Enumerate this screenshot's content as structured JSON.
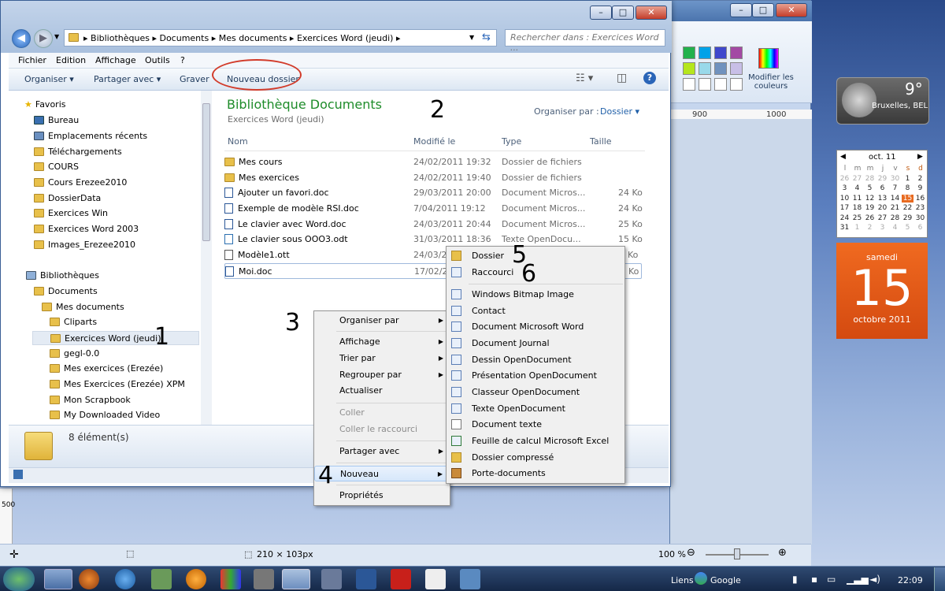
{
  "paint": {
    "modify_colors_label": "Modifier les couleurs",
    "ruler_900": "900",
    "ruler_1000": "1000",
    "left_ruler": "500",
    "selection_size": "210 × 103px",
    "zoom": "100 %"
  },
  "explorer": {
    "address": {
      "crumbs": [
        "Bibliothèques",
        "Documents",
        "Mes documents",
        "Exercices Word (jeudi)"
      ]
    },
    "search_placeholder": "Rechercher dans : Exercices Word ...",
    "menu": [
      "Fichier",
      "Edition",
      "Affichage",
      "Outils",
      "?"
    ],
    "toolbar": {
      "organize": "Organiser ▾",
      "share": "Partager avec ▾",
      "burn": "Graver",
      "new_folder": "Nouveau dossier"
    },
    "nav": {
      "favorites_header": "Favoris",
      "favorites": [
        "Bureau",
        "Emplacements récents",
        "Téléchargements",
        "COURS",
        "Cours Erezee2010",
        "DossierData",
        "Exercices Win",
        "Exercices Word 2003",
        "Images_Erezee2010"
      ],
      "libraries_header": "Bibliothèques",
      "documents": "Documents",
      "my_documents": "Mes documents",
      "sub": [
        "Cliparts",
        "Exercices Word (jeudi)",
        "gegl-0.0",
        "Mes exercices (Erezée)",
        "Mes Exercices (Erezée) XPM",
        "Mon Scrapbook",
        "My Downloaded Video"
      ]
    },
    "library_title": "Bibliothèque Documents",
    "library_subtitle": "Exercices Word (jeudi)",
    "arrange_label": "Organiser par :",
    "arrange_value": "Dossier ▾",
    "columns": {
      "name": "Nom",
      "modified": "Modifié le",
      "type": "Type",
      "size": "Taille"
    },
    "files": [
      {
        "name": "Mes cours",
        "date": "24/02/2011 19:32",
        "type": "Dossier de fichiers",
        "size": ""
      },
      {
        "name": "Mes exercices",
        "date": "24/02/2011 19:40",
        "type": "Dossier de fichiers",
        "size": ""
      },
      {
        "name": "Ajouter un favori.doc",
        "date": "29/03/2011 20:00",
        "type": "Document Micros...",
        "size": "24 Ko"
      },
      {
        "name": "Exemple de modèle RSI.doc",
        "date": "7/04/2011 19:12",
        "type": "Document Micros...",
        "size": "24 Ko"
      },
      {
        "name": "Le clavier avec Word.doc",
        "date": "24/03/2011 20:44",
        "type": "Document Micros...",
        "size": "25 Ko"
      },
      {
        "name": "Le clavier sous OOO3.odt",
        "date": "31/03/2011 18:36",
        "type": "Texte OpenDocu...",
        "size": "15 Ko"
      },
      {
        "name": "Modèle1.ott",
        "date": "24/03/20",
        "type": "",
        "size": "Ko"
      },
      {
        "name": "Moi.doc",
        "date": "17/02/20",
        "type": "",
        "size": "Ko"
      }
    ],
    "item_count": "8 élément(s)"
  },
  "context_menu": {
    "items": [
      "Organiser par",
      "Affichage",
      "Trier par",
      "Regrouper par",
      "Actualiser",
      "Coller",
      "Coller le raccourci",
      "Partager avec",
      "Nouveau",
      "Propriétés"
    ]
  },
  "submenu": {
    "items": [
      "Dossier",
      "Raccourci",
      "Windows Bitmap Image",
      "Contact",
      "Document Microsoft Word",
      "Document Journal",
      "Dessin OpenDocument",
      "Présentation OpenDocument",
      "Classeur OpenDocument",
      "Texte OpenDocument",
      "Document texte",
      "Feuille de calcul Microsoft Excel",
      "Dossier compressé",
      "Porte-documents"
    ]
  },
  "annotations": [
    "1",
    "2",
    "3",
    "4",
    "5",
    "6"
  ],
  "gadgets": {
    "weather_temp": "9°",
    "weather_city": "Bruxelles, BEL",
    "cal_month": "oct. 11",
    "cal_days_header": [
      "l",
      "m",
      "m",
      "j",
      "v",
      "s",
      "d"
    ],
    "cal_rows": [
      [
        "26",
        "27",
        "28",
        "29",
        "30",
        "1",
        "2"
      ],
      [
        "3",
        "4",
        "5",
        "6",
        "7",
        "8",
        "9"
      ],
      [
        "10",
        "11",
        "12",
        "13",
        "14",
        "15",
        "16"
      ],
      [
        "17",
        "18",
        "19",
        "20",
        "21",
        "22",
        "23"
      ],
      [
        "24",
        "25",
        "26",
        "27",
        "28",
        "29",
        "30"
      ],
      [
        "31",
        "1",
        "2",
        "3",
        "4",
        "5",
        "6"
      ]
    ],
    "big_weekday": "samedi",
    "big_day": "15",
    "big_month": "octobre 2011"
  },
  "taskbar": {
    "links": "Liens",
    "google": "Google",
    "clock": "22:09"
  }
}
